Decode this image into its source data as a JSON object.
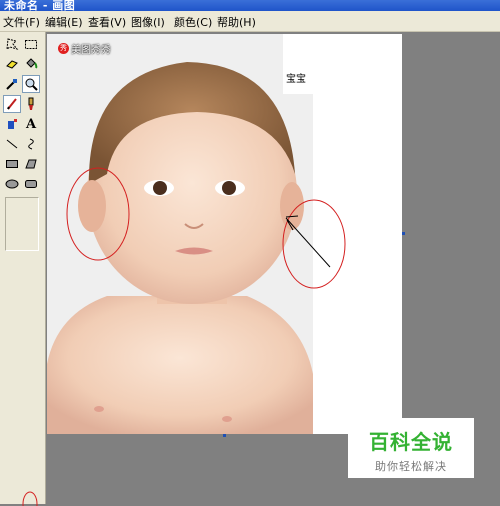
{
  "window": {
    "title": "未命名 - 画图"
  },
  "menu": [
    {
      "label": "文件(F)"
    },
    {
      "label": "编辑(E)"
    },
    {
      "label": "查看(V)"
    },
    {
      "label": "图像(I)"
    },
    {
      "label": "颜色(C)"
    },
    {
      "label": "帮助(H)"
    }
  ],
  "tools": [
    {
      "icon": "free-select-icon"
    },
    {
      "icon": "rect-select-icon"
    },
    {
      "icon": "eraser-icon"
    },
    {
      "icon": "fill-icon"
    },
    {
      "icon": "eyedropper-icon"
    },
    {
      "icon": "magnifier-icon"
    },
    {
      "icon": "pencil-icon",
      "selected": true
    },
    {
      "icon": "brush-icon"
    },
    {
      "icon": "airbrush-icon"
    },
    {
      "icon": "text-icon",
      "glyph": "A"
    },
    {
      "icon": "line-icon"
    },
    {
      "icon": "curve-icon"
    },
    {
      "icon": "rectangle-icon"
    },
    {
      "icon": "polygon-icon"
    },
    {
      "icon": "ellipse-icon"
    },
    {
      "icon": "rounded-rect-icon"
    }
  ],
  "canvas": {
    "label": "宝宝",
    "brand_badge": "秀",
    "brand_text": "美图秀秀"
  },
  "watermark": {
    "main": "百科全说",
    "sub": "助你轻松解决"
  },
  "colors": {
    "annotation": "#d42020",
    "watermark_green": "#34b233",
    "title_blue": "#1f54c9"
  }
}
